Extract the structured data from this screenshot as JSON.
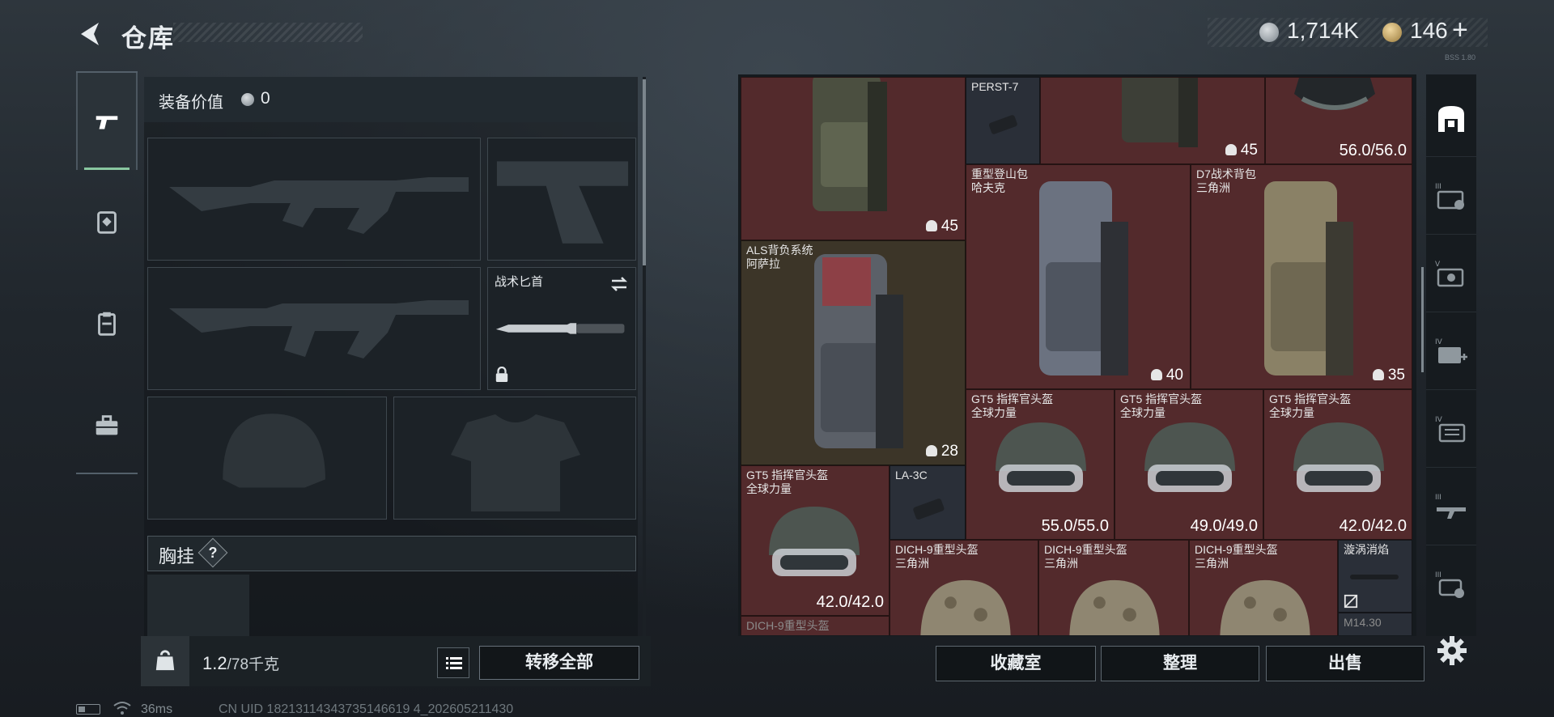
{
  "header": {
    "title": "仓库",
    "currency_silver": "1,714K",
    "currency_gold": "146",
    "add_label": "+",
    "small_note": "BSS 1.80"
  },
  "sidebar": {
    "tabs": [
      {
        "name": "weapons",
        "icon": "pistol-icon",
        "active": true
      },
      {
        "name": "supplies",
        "icon": "medkit-icon",
        "active": false
      },
      {
        "name": "containers",
        "icon": "clipboard-icon",
        "active": false
      },
      {
        "name": "tools",
        "icon": "toolbox-icon",
        "active": false
      }
    ]
  },
  "equipment": {
    "value_label": "装备价值",
    "value": "0",
    "knife_label": "战术匕首",
    "chest_label": "胸挂",
    "chest_help": "?",
    "weight_value": "1.2",
    "weight_capacity": "/78千克",
    "transfer_all": "转移全部"
  },
  "inventory": {
    "items": [
      {
        "id": "bag-top-left",
        "name": "",
        "qty": "45",
        "type": "qty",
        "bg": "red"
      },
      {
        "id": "perst",
        "name": "PERST-7",
        "qty": "",
        "type": "none",
        "bg": "gray"
      },
      {
        "id": "bag-top-mid",
        "name": "",
        "qty": "45",
        "type": "qty",
        "bg": "red"
      },
      {
        "id": "helmet-top",
        "name": "",
        "qty": "56.0/56.0",
        "type": "dur",
        "bg": "red"
      },
      {
        "id": "heavy-bag",
        "name": "重型登山包\n哈夫克",
        "qty": "40",
        "type": "qty",
        "bg": "red"
      },
      {
        "id": "d7-bag",
        "name": "D7战术背包\n三角洲",
        "qty": "35",
        "type": "qty",
        "bg": "red"
      },
      {
        "id": "als-bag",
        "name": "ALS背负系统\n阿萨拉",
        "qty": "28",
        "type": "qty",
        "bg": "olive"
      },
      {
        "id": "gt5-a",
        "name": "GT5 指挥官头盔\n全球力量",
        "qty": "55.0/55.0",
        "type": "dur",
        "bg": "red"
      },
      {
        "id": "gt5-b",
        "name": "GT5 指挥官头盔\n全球力量",
        "qty": "49.0/49.0",
        "type": "dur",
        "bg": "red"
      },
      {
        "id": "gt5-c",
        "name": "GT5 指挥官头盔\n全球力量",
        "qty": "42.0/42.0",
        "type": "dur",
        "bg": "red"
      },
      {
        "id": "gt5-d",
        "name": "GT5 指挥官头盔\n全球力量",
        "qty": "42.0/42.0",
        "type": "dur",
        "bg": "red"
      },
      {
        "id": "la3c",
        "name": "LA-3C",
        "qty": "",
        "type": "none",
        "bg": "gray"
      },
      {
        "id": "dich-a",
        "name": "DICH-9重型头盔\n三角洲",
        "qty": "",
        "type": "none",
        "bg": "red"
      },
      {
        "id": "dich-b",
        "name": "DICH-9重型头盔\n三角洲",
        "qty": "",
        "type": "none",
        "bg": "red"
      },
      {
        "id": "dich-c",
        "name": "DICH-9重型头盔\n三角洲",
        "qty": "",
        "type": "none",
        "bg": "red"
      },
      {
        "id": "vortex",
        "name": "漩涡消焰",
        "qty": "",
        "type": "none",
        "bg": "gray"
      },
      {
        "id": "dich-d",
        "name": "DICH-9重型头盔",
        "qty": "",
        "type": "none",
        "bg": "red"
      },
      {
        "id": "m14",
        "name": "M14.30",
        "qty": "",
        "type": "none",
        "bg": "gray"
      }
    ]
  },
  "right_sidebar": {
    "tabs": [
      {
        "name": "safe",
        "icon": "safe-icon",
        "roman": ""
      },
      {
        "name": "III-card",
        "icon": "keycard-icon",
        "roman": "III"
      },
      {
        "name": "V-card",
        "icon": "keycard-icon",
        "roman": "V"
      },
      {
        "name": "IV-plus",
        "icon": "medbox-icon",
        "roman": "IV"
      },
      {
        "name": "IV-card",
        "icon": "folder-icon",
        "roman": "IV"
      },
      {
        "name": "III-rifle",
        "icon": "rifle-icon",
        "roman": "III"
      },
      {
        "name": "III-hand",
        "icon": "hand-icon",
        "roman": "III"
      }
    ]
  },
  "actions": {
    "collection": "收藏室",
    "sort": "整理",
    "sell": "出售"
  },
  "status": {
    "ping": "36ms",
    "uid": "CN UID 18213114343735146619 4_202605211430"
  },
  "colors": {
    "grid_red": "#532a2c",
    "accent_green": "#89c7a0"
  }
}
